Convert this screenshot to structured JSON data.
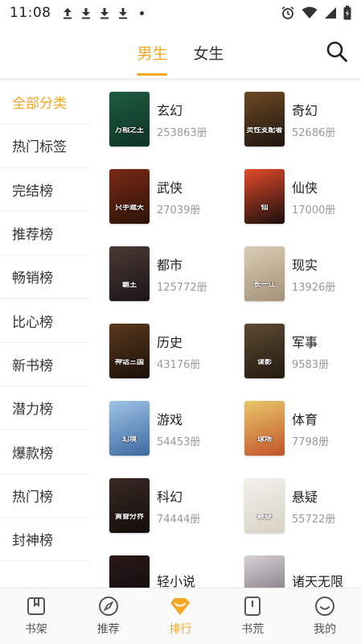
{
  "status_bar": {
    "time": "11:08"
  },
  "header": {
    "tabs": [
      {
        "label": "男生",
        "active": true
      },
      {
        "label": "女生",
        "active": false
      }
    ],
    "search_icon": "search-icon",
    "accent_color": "#f5a623"
  },
  "sidebar": {
    "items": [
      {
        "label": "全部分类",
        "active": true
      },
      {
        "label": "热门标签"
      },
      {
        "label": "完结榜"
      },
      {
        "label": "推荐榜"
      },
      {
        "label": "畅销榜"
      },
      {
        "label": "比心榜"
      },
      {
        "label": "新书榜"
      },
      {
        "label": "潜力榜"
      },
      {
        "label": "爆款榜"
      },
      {
        "label": "热门榜"
      },
      {
        "label": "封神榜"
      }
    ]
  },
  "categories": [
    {
      "name": "玄幻",
      "count": "253863册",
      "cover_text": "万相之王",
      "cover_colors": [
        "#1e5b40",
        "#0d3324"
      ]
    },
    {
      "name": "奇幻",
      "count": "52686册",
      "cover_text": "灵性支配者",
      "cover_colors": [
        "#6b4a23",
        "#201510"
      ]
    },
    {
      "name": "武侠",
      "count": "27039册",
      "cover_text": "只手遮天",
      "cover_colors": [
        "#7a2a15",
        "#2b1208"
      ]
    },
    {
      "name": "仙侠",
      "count": "17000册",
      "cover_text": "仙",
      "cover_colors": [
        "#e24a2a",
        "#1a0f0c"
      ]
    },
    {
      "name": "都市",
      "count": "125772册",
      "cover_text": "霸王",
      "cover_colors": [
        "#4a3a34",
        "#1c1418"
      ]
    },
    {
      "name": "现实",
      "count": "13926册",
      "cover_text": "长一江",
      "cover_colors": [
        "#d9cbb4",
        "#a6927a"
      ]
    },
    {
      "name": "历史",
      "count": "43176册",
      "cover_text": "神话三国",
      "cover_colors": [
        "#5a3a1e",
        "#1a0f08"
      ]
    },
    {
      "name": "军事",
      "count": "9583册",
      "cover_text": "谍影",
      "cover_colors": [
        "#5d4a33",
        "#231a10"
      ]
    },
    {
      "name": "游戏",
      "count": "54453册",
      "cover_text": "幻境",
      "cover_colors": [
        "#9ec3e6",
        "#3d6aa0"
      ]
    },
    {
      "name": "体育",
      "count": "7798册",
      "cover_text": "球场",
      "cover_colors": [
        "#e9c86a",
        "#c2542b"
      ]
    },
    {
      "name": "科幻",
      "count": "74444册",
      "cover_text": "黄昏分界",
      "cover_colors": [
        "#3a2a25",
        "#120c0a"
      ]
    },
    {
      "name": "悬疑",
      "count": "55722册",
      "cover_text": "悬疑",
      "cover_colors": [
        "#f3f1ec",
        "#d9d2c4"
      ]
    },
    {
      "name": "轻小说",
      "count": "",
      "cover_text": "",
      "cover_colors": [
        "#2b1a1a",
        "#0d0808"
      ]
    },
    {
      "name": "诸天无限",
      "count": "",
      "cover_text": "",
      "cover_colors": [
        "#d6d0d4",
        "#6f6570"
      ]
    }
  ],
  "bottom_nav": {
    "items": [
      {
        "label": "书架",
        "icon": "bookshelf-icon",
        "active": false
      },
      {
        "label": "推荐",
        "icon": "compass-icon",
        "active": false
      },
      {
        "label": "排行",
        "icon": "ranking-diamond-icon",
        "active": true
      },
      {
        "label": "书荒",
        "icon": "book-icon",
        "active": false
      },
      {
        "label": "我的",
        "icon": "smiley-icon",
        "active": false
      }
    ]
  }
}
